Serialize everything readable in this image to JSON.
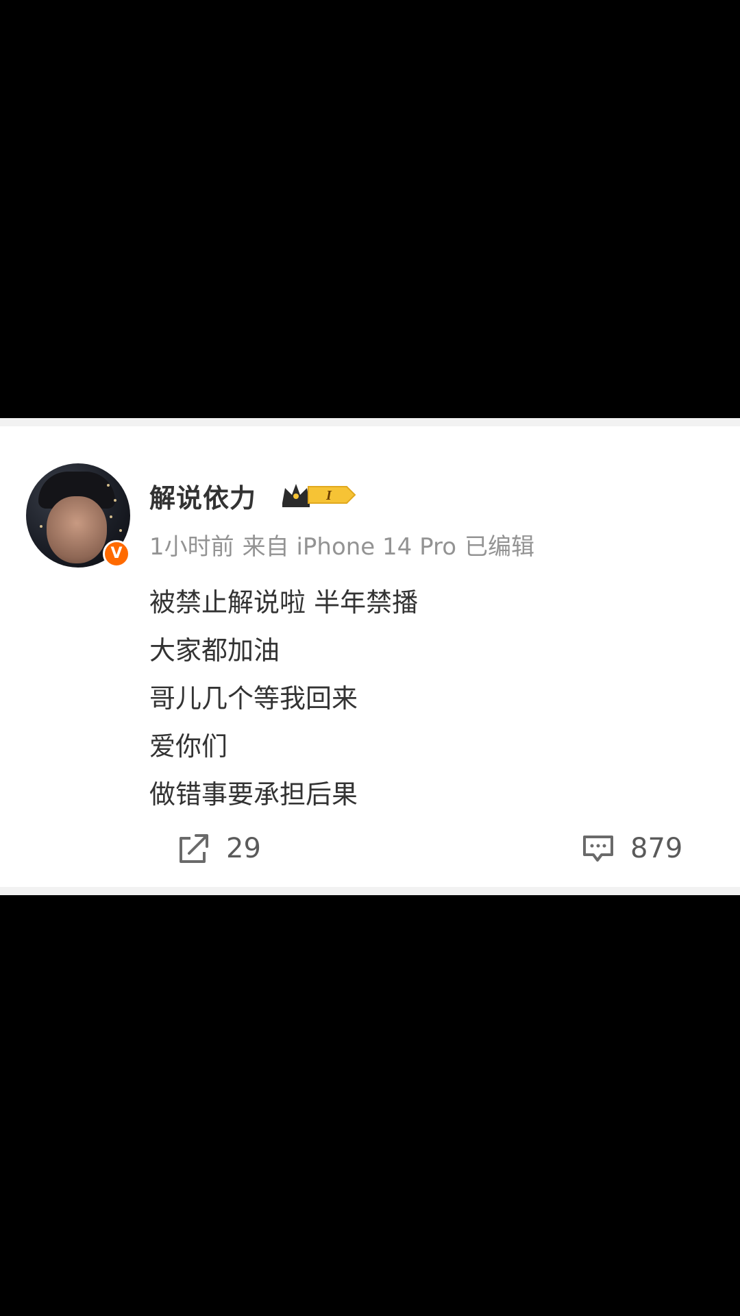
{
  "post": {
    "username": "解说依力",
    "member_badge_text": "I",
    "verified_badge": "V",
    "meta": {
      "time": "1小时前",
      "source": "来自 iPhone 14 Pro",
      "edited": "已编辑"
    },
    "content_lines": [
      "被禁止解说啦 半年禁播",
      "大家都加油",
      "哥儿几个等我回来",
      "爱你们",
      "做错事要承担后果"
    ],
    "actions": {
      "repost_count": "29",
      "comment_count": "879"
    },
    "icons": {
      "repost": "share-icon",
      "comment": "comment-icon",
      "crown": "crown-icon"
    }
  },
  "colors": {
    "background": "#000000",
    "card": "#ffffff",
    "verified_orange": "#ff6a00",
    "badge_gold": "#f6c335"
  }
}
